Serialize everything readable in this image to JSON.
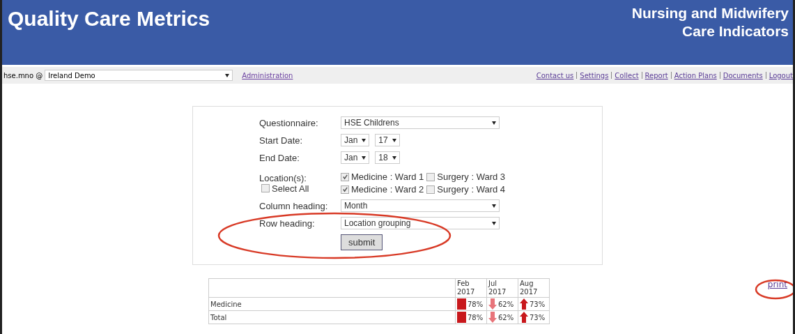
{
  "header": {
    "title": "Quality Care Metrics",
    "subtitle_lines": [
      "Nursing and Midwifery",
      "Care Indicators"
    ]
  },
  "nav": {
    "user": "hse.mno @",
    "organisation": "Ireland Demo",
    "admin_link": "Administration",
    "links": [
      "Contact us",
      "Settings",
      "Collect",
      "Report",
      "Action Plans",
      "Documents",
      "Logout"
    ]
  },
  "form": {
    "questionnaire_label": "Questionnaire:",
    "questionnaire": "HSE Childrens",
    "start_label": "Start Date:",
    "start_month": "Jan",
    "start_year": "17",
    "end_label": "End Date:",
    "end_month": "Jan",
    "end_year": "18",
    "locations_label": "Location(s):",
    "select_all": {
      "label": "Select All",
      "checked": false
    },
    "locations": [
      {
        "label": "Medicine : Ward 1",
        "checked": true
      },
      {
        "label": "Surgery : Ward 3",
        "checked": false
      },
      {
        "label": "Medicine : Ward 2",
        "checked": true
      },
      {
        "label": "Surgery : Ward 4",
        "checked": false
      }
    ],
    "column_label": "Column heading:",
    "column_value": "Month",
    "row_label": "Row heading:",
    "row_value": "Location grouping",
    "submit": "submit"
  },
  "table": {
    "columns": [
      "Feb 2017",
      "Jul 2017",
      "Aug 2017"
    ],
    "rows": [
      {
        "name": "Medicine",
        "cells": [
          {
            "kind": "flat",
            "value": "78%"
          },
          {
            "kind": "down",
            "value": "62%"
          },
          {
            "kind": "up",
            "value": "73%"
          }
        ]
      },
      {
        "name": "Total",
        "cells": [
          {
            "kind": "flat",
            "value": "78%"
          },
          {
            "kind": "down",
            "value": "62%"
          },
          {
            "kind": "up",
            "value": "73%"
          }
        ]
      }
    ]
  },
  "print_link": "print"
}
